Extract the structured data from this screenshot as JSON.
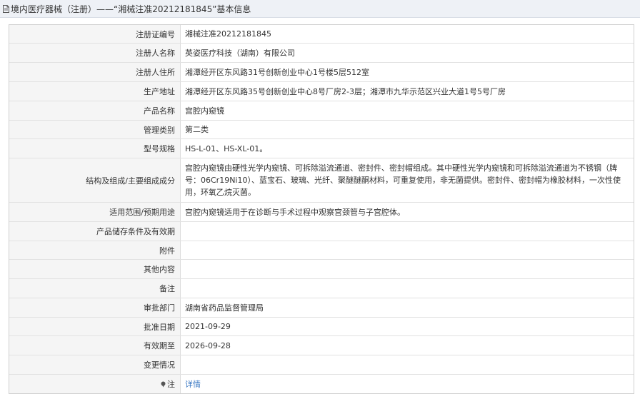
{
  "header": {
    "title": "境内医疗器械（注册）——“湘械注准20212181845”基本信息"
  },
  "rows": [
    {
      "label": "注册证编号",
      "value": "湘械注准20212181845"
    },
    {
      "label": "注册人名称",
      "value": "英姿医疗科技（湖南）有限公司"
    },
    {
      "label": "注册人住所",
      "value": "湘潭经开区东风路31号创新创业中心1号楼5层512室"
    },
    {
      "label": "生产地址",
      "value": "湘潭经开区东风路35号创新创业中心8号厂房2-3层；湘潭市九华示范区兴业大道1号5号厂房"
    },
    {
      "label": "产品名称",
      "value": "宫腔内窥镜"
    },
    {
      "label": "管理类别",
      "value": "第二类"
    },
    {
      "label": "型号规格",
      "value": "HS-L-01、HS-XL-01。"
    },
    {
      "label": "结构及组成/主要组成成分",
      "value": "宫腔内窥镜由硬性光学内窥镜、可拆除溢流通道、密封件、密封帽组成。其中硬性光学内窥镜和可拆除溢流通道为不锈钢（牌号：06Cr19Ni10）、蓝宝石、玻璃、光纤、聚醚醚酮材料，可重复使用，非无菌提供。密封件、密封帽为橡胶材料，一次性使用，环氧乙烷灭菌。"
    },
    {
      "label": "适用范围/预期用途",
      "value": "宫腔内窥镜适用于在诊断与手术过程中观察宫颈管与子宫腔体。"
    },
    {
      "label": "产品储存条件及有效期",
      "value": ""
    },
    {
      "label": "附件",
      "value": ""
    },
    {
      "label": "其他内容",
      "value": ""
    },
    {
      "label": "备注",
      "value": ""
    },
    {
      "label": "审批部门",
      "value": "湖南省药品监督管理局"
    },
    {
      "label": "批准日期",
      "value": "2021-09-29"
    },
    {
      "label": "有效期至",
      "value": "2026-09-28"
    },
    {
      "label": "变更情况",
      "value": ""
    },
    {
      "label": "注",
      "value": "详情"
    }
  ],
  "icons": {
    "header_icon": "document-icon",
    "note_icon": "pin-icon"
  },
  "colors": {
    "link": "#3a78c3",
    "label_bg": "#f5f5f5",
    "header_bg": "#eef1f6"
  }
}
